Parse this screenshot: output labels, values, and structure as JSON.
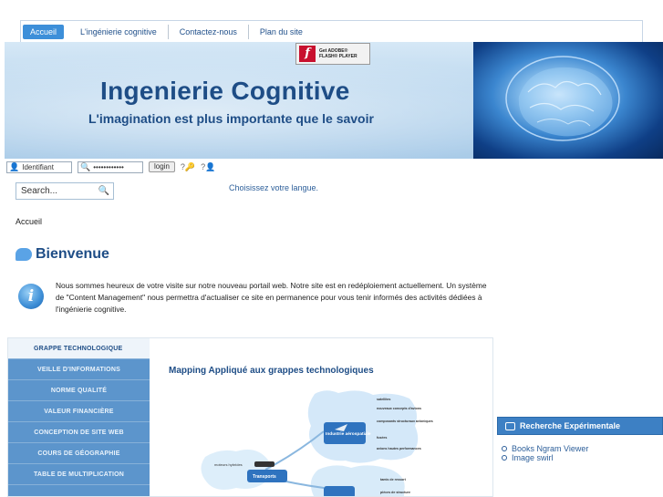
{
  "nav": {
    "items": [
      {
        "label": "Accueil"
      },
      {
        "label": "L'ingénierie cognitive"
      },
      {
        "label": "Contactez-nous"
      },
      {
        "label": "Plan du site"
      }
    ]
  },
  "header": {
    "title": "Ingenierie Cognitive",
    "slogan": "L'imagination est plus importante que le savoir",
    "flash_badge_line1": "Get ADOBE®",
    "flash_badge_line2": "FLASH® PLAYER"
  },
  "login": {
    "username_placeholder": "Identifiant",
    "password_value": "••••••••••••",
    "button_label": "login",
    "help_icons": [
      "help-icon",
      "help-user-icon"
    ]
  },
  "search": {
    "placeholder": "Search..."
  },
  "language_link": "Choisissez votre langue.",
  "breadcrumb": "Accueil",
  "welcome": {
    "title": "Bienvenue",
    "text": "Nous sommes heureux de votre visite sur notre nouveau portail web. Notre site est en redéploiement actuellement. Un système de \"Content Management\" nous permettra d'actualiser ce site en permanence pour vous tenir informés des activités dédiées à l'ingénierie cognitive."
  },
  "side_menu": {
    "items": [
      {
        "label": "GRAPPE TECHNOLOGIQUE"
      },
      {
        "label": "VEILLE D'INFORMATIONS"
      },
      {
        "label": "NORME QUALITÉ"
      },
      {
        "label": "VALEUR FINANCIÈRE"
      },
      {
        "label": "CONCEPTION DE SITE WEB"
      },
      {
        "label": "COURS DE GÉOGRAPHIE"
      },
      {
        "label": "TABLE DE MULTIPLICATION"
      }
    ]
  },
  "panel": {
    "title": "Mapping Appliqué aux grappes technologiques",
    "mindmap": {
      "node_aero": "Industrie aérospatiale",
      "node_transport": "Transports",
      "left_label": "moteurs hybrides",
      "aero_items": [
        "satellites",
        "nouveaux concepts d'avions",
        "composants structuraux avioniques",
        "fusées",
        "avions hautes performances"
      ],
      "lower_items": [
        "tamis de ressort",
        "pièces de structure"
      ]
    }
  },
  "right_sidebar": {
    "box_title": "Recherche Expérimentale",
    "links": [
      {
        "label": "Books Ngram Viewer"
      },
      {
        "label": "Image swirl"
      }
    ]
  },
  "colors": {
    "accent": "#3d8fd9",
    "title_blue": "#1e4d86",
    "menu_blue": "#5c95cc"
  }
}
